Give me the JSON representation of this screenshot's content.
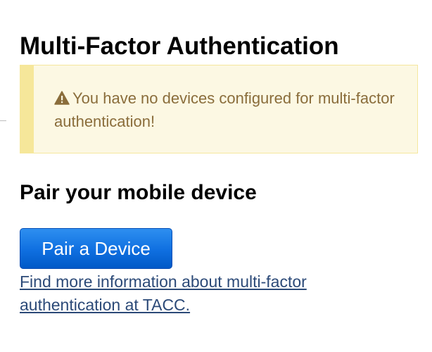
{
  "page": {
    "title": "Multi-Factor Authentication"
  },
  "alert": {
    "icon": "warning-icon",
    "message": "You have no devices configured for multi-factor authentication!",
    "color": "#8a6d3b",
    "background": "#fcf8e3"
  },
  "pairing": {
    "heading": "Pair your mobile device",
    "button_label": "Pair a Device",
    "button_color": "#0f6fe0",
    "info_link": "Find more information about multi-factor authentication at TACC."
  }
}
